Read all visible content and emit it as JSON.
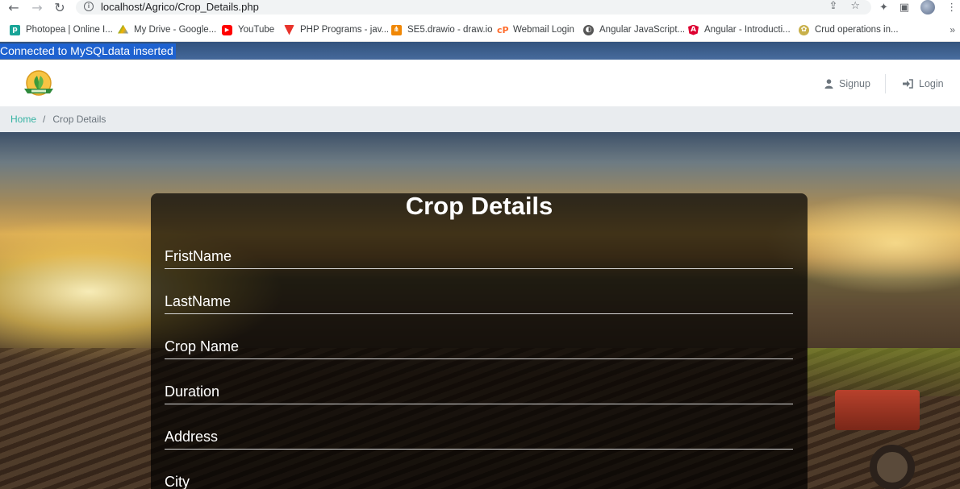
{
  "browser": {
    "url": "localhost/Agrico/Crop_Details.php",
    "bookmarks": [
      {
        "label": "Photopea | Online I...",
        "icon": "photopea-icon",
        "color": "#18a497"
      },
      {
        "label": "My Drive - Google...",
        "icon": "google-drive-icon",
        "color": "#f4b400"
      },
      {
        "label": "YouTube",
        "icon": "youtube-icon",
        "color": "#ff0000"
      },
      {
        "label": "PHP Programs - jav...",
        "icon": "php-programs-icon",
        "color": "#e8332b"
      },
      {
        "label": "SE5.drawio - draw.io",
        "icon": "drawio-icon",
        "color": "#f08705"
      },
      {
        "label": "Webmail Login",
        "icon": "webmail-icon",
        "color": "#ff6c2c"
      },
      {
        "label": "Angular JavaScript...",
        "icon": "angular-js-icon",
        "color": "#555555"
      },
      {
        "label": "Angular - Introducti...",
        "icon": "angular-icon",
        "color": "#dd0031"
      },
      {
        "label": "Crud operations in...",
        "icon": "crud-icon",
        "color": "#c8b04a"
      }
    ],
    "more": "»"
  },
  "status": {
    "db_message": "Connected to MySQLdata inserted"
  },
  "header": {
    "logo_name": "agrico-logo",
    "signup": "Signup",
    "login": "Login"
  },
  "breadcrumb": {
    "home": "Home",
    "separator": "/",
    "current": "Crop Details"
  },
  "form": {
    "title": "Crop Details",
    "fields": [
      {
        "name": "first-name-field",
        "placeholder": "FristName"
      },
      {
        "name": "last-name-field",
        "placeholder": "LastName"
      },
      {
        "name": "crop-name-field",
        "placeholder": "Crop Name"
      },
      {
        "name": "duration-field",
        "placeholder": "Duration"
      },
      {
        "name": "address-field",
        "placeholder": "Address"
      },
      {
        "name": "city-field",
        "placeholder": "City"
      }
    ]
  },
  "colors": {
    "accent": "#35b3a3",
    "status_bg": "#1e62d0"
  }
}
